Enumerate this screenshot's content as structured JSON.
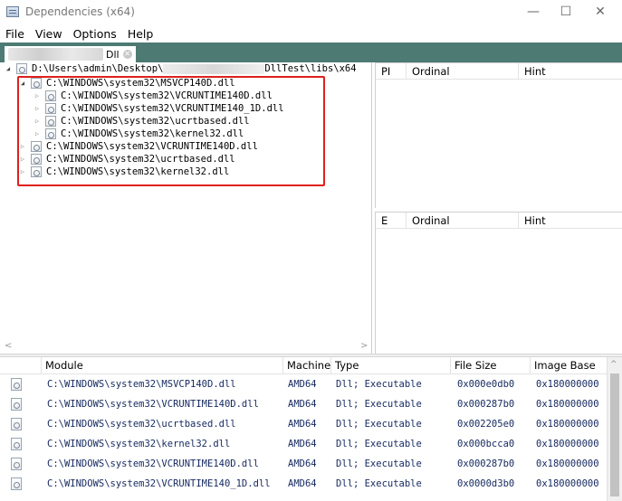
{
  "window": {
    "title": "Dependencies (x64)",
    "minimize": "—",
    "maximize": "☐",
    "close": "✕"
  },
  "menu": [
    "File",
    "View",
    "Options",
    "Help"
  ],
  "tab": {
    "label": "Dll"
  },
  "tree": {
    "root_prefix": "D:\\Users\\admin\\Desktop\\",
    "root_suffix": "DllTest\\libs\\x64",
    "items": [
      {
        "label": "C:\\WINDOWS\\system32\\MSVCP140D.dll",
        "level": 1,
        "expanded": true
      },
      {
        "label": "C:\\WINDOWS\\system32\\VCRUNTIME140D.dll",
        "level": 2,
        "expanded": false
      },
      {
        "label": "C:\\WINDOWS\\system32\\VCRUNTIME140_1D.dll",
        "level": 2,
        "expanded": false
      },
      {
        "label": "C:\\WINDOWS\\system32\\ucrtbased.dll",
        "level": 2,
        "expanded": false
      },
      {
        "label": "C:\\WINDOWS\\system32\\kernel32.dll",
        "level": 2,
        "expanded": false
      },
      {
        "label": "C:\\WINDOWS\\system32\\VCRUNTIME140D.dll",
        "level": 1,
        "expanded": false
      },
      {
        "label": "C:\\WINDOWS\\system32\\ucrtbased.dll",
        "level": 1,
        "expanded": false
      },
      {
        "label": "C:\\WINDOWS\\system32\\kernel32.dll",
        "level": 1,
        "expanded": false
      }
    ]
  },
  "imports_table": {
    "col_pi": "PI",
    "col_ordinal": "Ordinal",
    "col_hint": "Hint"
  },
  "exports_table": {
    "col_e": "E",
    "col_ordinal": "Ordinal",
    "col_hint": "Hint"
  },
  "modules": {
    "headers": {
      "module": "Module",
      "machine": "Machine",
      "type": "Type",
      "file_size": "File Size",
      "image_base": "Image Base"
    },
    "rows": [
      {
        "module": "C:\\WINDOWS\\system32\\MSVCP140D.dll",
        "machine": "AMD64",
        "type": "Dll; Executable",
        "file_size": "0x000e0db0",
        "image_base": "0x180000000"
      },
      {
        "module": "C:\\WINDOWS\\system32\\VCRUNTIME140D.dll",
        "machine": "AMD64",
        "type": "Dll; Executable",
        "file_size": "0x000287b0",
        "image_base": "0x180000000"
      },
      {
        "module": "C:\\WINDOWS\\system32\\ucrtbased.dll",
        "machine": "AMD64",
        "type": "Dll; Executable",
        "file_size": "0x002205e0",
        "image_base": "0x180000000"
      },
      {
        "module": "C:\\WINDOWS\\system32\\kernel32.dll",
        "machine": "AMD64",
        "type": "Dll; Executable",
        "file_size": "0x000bcca0",
        "image_base": "0x180000000"
      },
      {
        "module": "C:\\WINDOWS\\system32\\VCRUNTIME140D.dll",
        "machine": "AMD64",
        "type": "Dll; Executable",
        "file_size": "0x000287b0",
        "image_base": "0x180000000"
      },
      {
        "module": "C:\\WINDOWS\\system32\\VCRUNTIME140_1D.dll",
        "machine": "AMD64",
        "type": "Dll; Executable",
        "file_size": "0x0000d3b0",
        "image_base": "0x180000000"
      }
    ]
  },
  "colors": {
    "highlight_box": "#e0201c",
    "tab_strip": "#4d7a73",
    "table_text": "#14285f"
  }
}
